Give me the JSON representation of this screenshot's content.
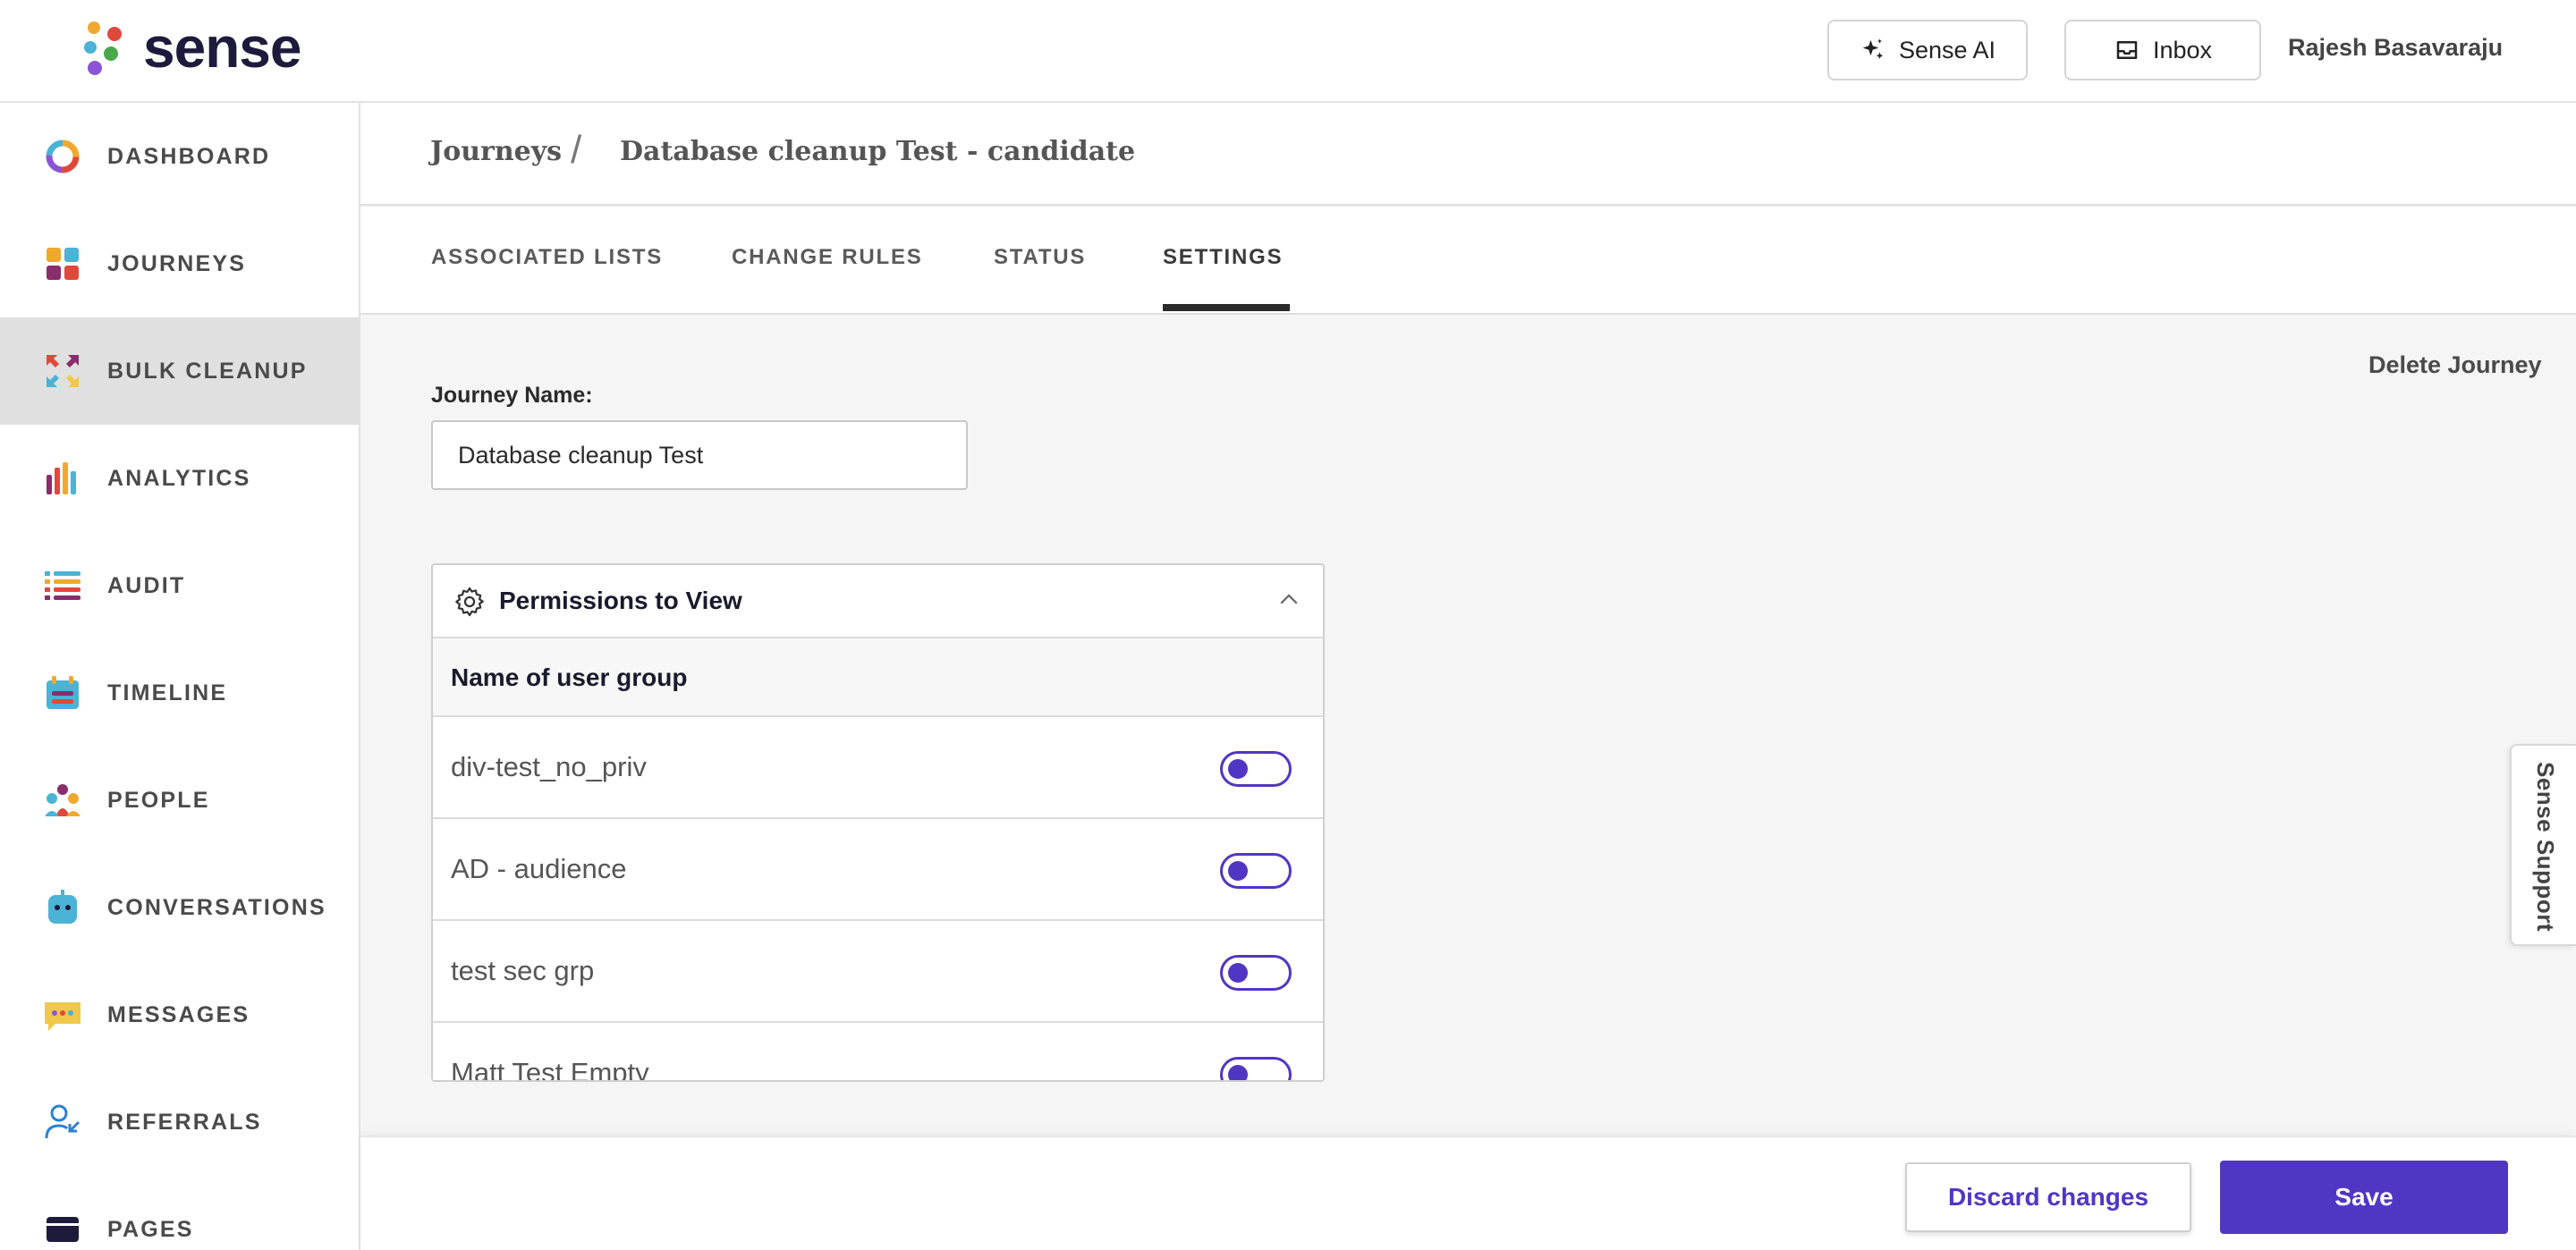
{
  "brand": {
    "name": "sense",
    "accent": "#5136c4"
  },
  "header": {
    "ai_button": "Sense AI",
    "inbox_button": "Inbox",
    "user_name": "Rajesh Basavaraju"
  },
  "sidebar": {
    "items": [
      {
        "label": "DASHBOARD",
        "icon": "dashboard-ring-icon"
      },
      {
        "label": "JOURNEYS",
        "icon": "journeys-grid-icon"
      },
      {
        "label": "BULK CLEANUP",
        "icon": "bulk-cleanup-arrows-icon",
        "active": true
      },
      {
        "label": "ANALYTICS",
        "icon": "analytics-bars-icon"
      },
      {
        "label": "AUDIT",
        "icon": "audit-list-icon"
      },
      {
        "label": "TIMELINE",
        "icon": "timeline-calendar-icon"
      },
      {
        "label": "PEOPLE",
        "icon": "people-group-icon"
      },
      {
        "label": "CONVERSATIONS",
        "icon": "conversations-robot-icon"
      },
      {
        "label": "MESSAGES",
        "icon": "messages-bubble-icon"
      },
      {
        "label": "REFERRALS",
        "icon": "referrals-user-icon"
      },
      {
        "label": "PAGES",
        "icon": "pages-window-icon"
      }
    ]
  },
  "breadcrumb": {
    "root": "Journeys",
    "separator": "/",
    "current": "Database cleanup Test - candidate"
  },
  "tabs": [
    {
      "label": "ASSOCIATED LISTS"
    },
    {
      "label": "CHANGE RULES"
    },
    {
      "label": "STATUS"
    },
    {
      "label": "SETTINGS",
      "active": true
    }
  ],
  "settings": {
    "delete_label": "Delete Journey",
    "journey_name_label": "Journey Name:",
    "journey_name_value": "Database cleanup Test"
  },
  "permissions": {
    "title": "Permissions to View",
    "column_header": "Name of user group",
    "groups": [
      {
        "name": "div-test_no_priv",
        "enabled": false
      },
      {
        "name": "AD - audience",
        "enabled": false
      },
      {
        "name": "test sec grp",
        "enabled": false
      },
      {
        "name": "Matt Test Empty",
        "enabled": false
      }
    ]
  },
  "support_tab": "Sense Support",
  "footer": {
    "discard_label": "Discard changes",
    "save_label": "Save"
  }
}
